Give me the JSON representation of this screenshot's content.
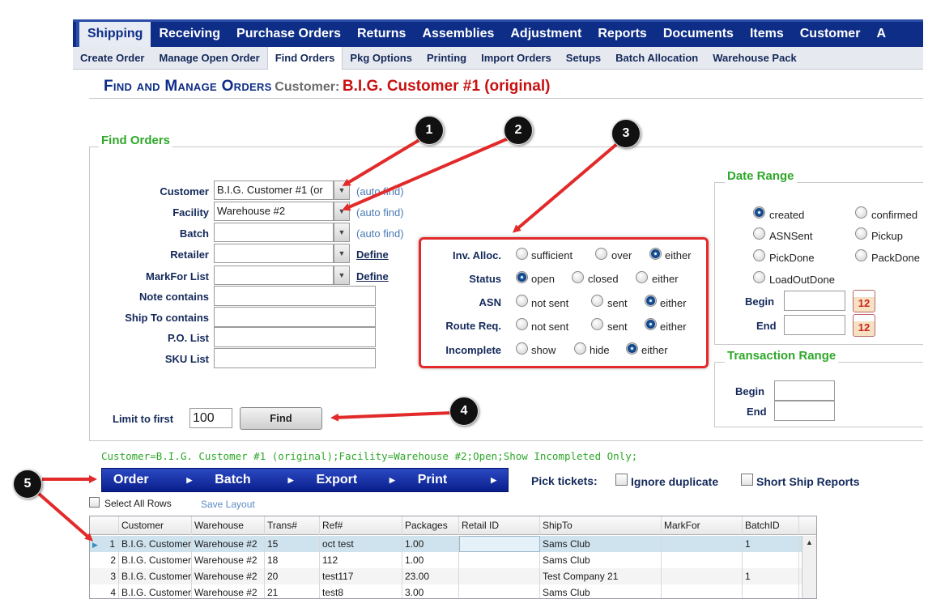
{
  "main_nav": [
    "Shipping",
    "Receiving",
    "Purchase Orders",
    "Returns",
    "Assemblies",
    "Adjustment",
    "Reports",
    "Documents",
    "Items",
    "Customer",
    "A"
  ],
  "sub_nav": [
    "Create Order",
    "Manage Open Order",
    "Find Orders",
    "Pkg Options",
    "Printing",
    "Import Orders",
    "Setups",
    "Batch Allocation",
    "Warehouse Pack"
  ],
  "page": {
    "title": "Find and Manage Orders",
    "customer_label": "Customer:",
    "customer_name": "B.I.G. Customer #1 (original)"
  },
  "find": {
    "legend": "Find Orders",
    "customer": {
      "label": "Customer",
      "value": "B.I.G. Customer #1 (or",
      "auto": "(auto find)"
    },
    "facility": {
      "label": "Facility",
      "value": "Warehouse #2",
      "auto": "(auto find)"
    },
    "batch": {
      "label": "Batch",
      "value": "",
      "auto": "(auto find)"
    },
    "retailer": {
      "label": "Retailer",
      "value": "",
      "define": "Define"
    },
    "markfor": {
      "label": "MarkFor List",
      "value": "",
      "define": "Define"
    },
    "note": {
      "label": "Note contains"
    },
    "shipto": {
      "label": "Ship To contains"
    },
    "po": {
      "label": "P.O. List"
    },
    "sku": {
      "label": "SKU List"
    },
    "limit_label": "Limit to first",
    "limit_value": "100",
    "find_button": "Find"
  },
  "options": {
    "inv": {
      "label": "Inv. Alloc.",
      "opts": [
        "sufficient",
        "over",
        "either"
      ],
      "selected": 2
    },
    "status": {
      "label": "Status",
      "opts": [
        "open",
        "closed",
        "either"
      ],
      "selected": 0
    },
    "asn": {
      "label": "ASN",
      "opts": [
        "not sent",
        "sent",
        "either"
      ],
      "selected": 2
    },
    "route": {
      "label": "Route Req.",
      "opts": [
        "not sent",
        "sent",
        "either"
      ],
      "selected": 2
    },
    "incomplete": {
      "label": "Incomplete",
      "opts": [
        "show",
        "hide",
        "either"
      ],
      "selected": 2
    }
  },
  "date_range": {
    "legend": "Date Range",
    "opts": [
      "created",
      "confirmed",
      "ASNSent",
      "Pickup",
      "PickDone",
      "PackDone",
      "LoadOutDone"
    ],
    "selected": "created",
    "begin": "Begin",
    "end": "End",
    "cal": "12"
  },
  "trans_range": {
    "legend": "Transaction Range",
    "begin": "Begin",
    "end": "End"
  },
  "summary": "Customer=B.I.G. Customer #1 (original);Facility=Warehouse #2;Open;Show Incompleted Only;",
  "action_bar": [
    "Order",
    "Batch",
    "Export",
    "Print"
  ],
  "pick_tickets": {
    "label": "Pick tickets:",
    "ignore": "Ignore duplicate",
    "short": "Short Ship Reports"
  },
  "select_all": "Select All Rows",
  "save_layout": "Save Layout",
  "grid": {
    "columns": [
      "Customer",
      "Warehouse",
      "Trans#",
      "Ref#",
      "Packages",
      "Retail ID",
      "ShipTo",
      "MarkFor",
      "BatchID"
    ],
    "rows": [
      {
        "n": "1",
        "customer": "B.I.G. Customer",
        "warehouse": "Warehouse #2",
        "trans": "15",
        "ref": "oct test",
        "packages": "1.00",
        "retail": "",
        "shipto": "Sams Club",
        "markfor": "",
        "batch": "1"
      },
      {
        "n": "2",
        "customer": "B.I.G. Customer",
        "warehouse": "Warehouse #2",
        "trans": "18",
        "ref": "112",
        "packages": "1.00",
        "retail": "",
        "shipto": "Sams Club",
        "markfor": "",
        "batch": ""
      },
      {
        "n": "3",
        "customer": "B.I.G. Customer",
        "warehouse": "Warehouse #2",
        "trans": "20",
        "ref": "test117",
        "packages": "23.00",
        "retail": "",
        "shipto": "Test Company 21",
        "markfor": "",
        "batch": "1"
      },
      {
        "n": "4",
        "customer": "B.I.G. Customer",
        "warehouse": "Warehouse #2",
        "trans": "21",
        "ref": "test8",
        "packages": "3.00",
        "retail": "",
        "shipto": "Sams Club",
        "markfor": "",
        "batch": ""
      }
    ]
  },
  "callouts": [
    "1",
    "2",
    "3",
    "4",
    "5"
  ],
  "colors": {
    "nav": "#0d2d87",
    "legend": "#2fa82a",
    "title_red": "#c81010",
    "callout_arrow": "#e22a2a"
  }
}
